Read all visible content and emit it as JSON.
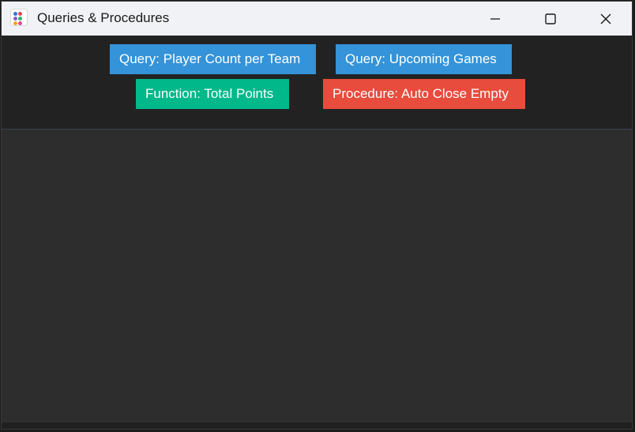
{
  "window": {
    "title": "Queries & Procedures"
  },
  "title_icon_colors": [
    "#3b6fd8",
    "#e8434f",
    "#8b59c9",
    "#2fb36a",
    "#f4a21e",
    "#e84393"
  ],
  "toolbar": {
    "buttons": [
      {
        "label": "Query: Player Count per Team",
        "color": "#3493d9"
      },
      {
        "label": "Query: Upcoming Games",
        "color": "#3493d9"
      },
      {
        "label": "Function: Total Points",
        "color": "#00b88a"
      },
      {
        "label": "Procedure: Auto Close Empty",
        "color": "#e74c3c"
      }
    ]
  },
  "window_controls": {
    "minimize": "minimize-icon",
    "maximize": "maximize-icon",
    "close": "close-icon"
  }
}
